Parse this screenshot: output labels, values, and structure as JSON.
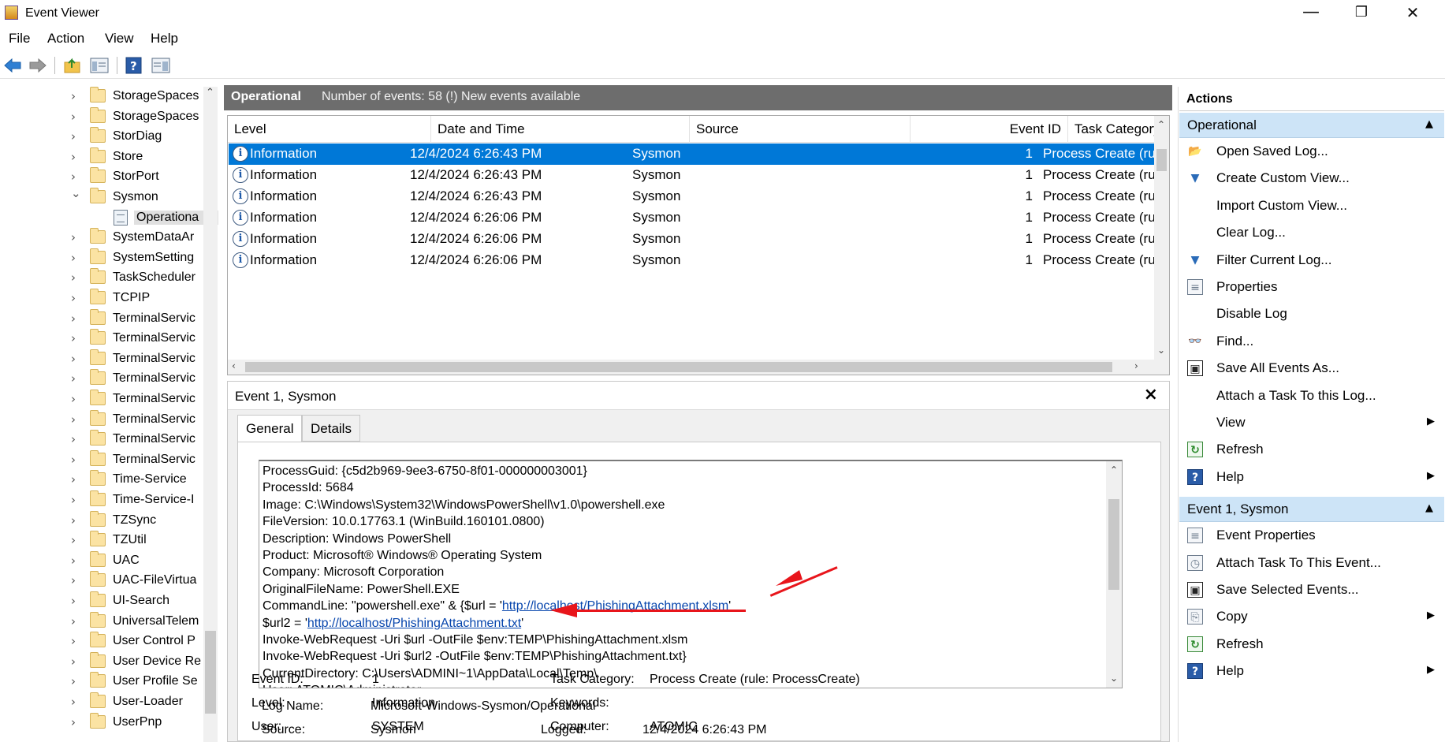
{
  "window": {
    "title": "Event Viewer",
    "minimize": "—",
    "maximize": "❐",
    "close": "✕"
  },
  "menu": [
    "File",
    "Action",
    "View",
    "Help"
  ],
  "tree": {
    "items": [
      {
        "label": "StorageSpaces",
        "expanded": false
      },
      {
        "label": "StorageSpaces",
        "expanded": false
      },
      {
        "label": "StorDiag",
        "expanded": false
      },
      {
        "label": "Store",
        "expanded": false
      },
      {
        "label": "StorPort",
        "expanded": false
      },
      {
        "label": "Sysmon",
        "expanded": true
      },
      {
        "label": "Operationa",
        "selected": true
      },
      {
        "label": "SystemDataAr",
        "expanded": false
      },
      {
        "label": "SystemSetting",
        "expanded": false
      },
      {
        "label": "TaskScheduler",
        "expanded": false
      },
      {
        "label": "TCPIP",
        "expanded": false
      },
      {
        "label": "TerminalServic",
        "expanded": false
      },
      {
        "label": "TerminalServic",
        "expanded": false
      },
      {
        "label": "TerminalServic",
        "expanded": false
      },
      {
        "label": "TerminalServic",
        "expanded": false
      },
      {
        "label": "TerminalServic",
        "expanded": false
      },
      {
        "label": "TerminalServic",
        "expanded": false
      },
      {
        "label": "TerminalServic",
        "expanded": false
      },
      {
        "label": "TerminalServic",
        "expanded": false
      },
      {
        "label": "Time-Service",
        "expanded": false
      },
      {
        "label": "Time-Service-I",
        "expanded": false
      },
      {
        "label": "TZSync",
        "expanded": false
      },
      {
        "label": "TZUtil",
        "expanded": false
      },
      {
        "label": "UAC",
        "expanded": false
      },
      {
        "label": "UAC-FileVirtua",
        "expanded": false
      },
      {
        "label": "UI-Search",
        "expanded": false
      },
      {
        "label": "UniversalTelem",
        "expanded": false
      },
      {
        "label": "User Control P",
        "expanded": false
      },
      {
        "label": "User Device Re",
        "expanded": false
      },
      {
        "label": "User Profile Se",
        "expanded": false
      },
      {
        "label": "User-Loader",
        "expanded": false
      },
      {
        "label": "UserPnp",
        "expanded": false
      }
    ]
  },
  "log_header": {
    "title": "Operational",
    "count": "Number of events: 58 (!) New events available"
  },
  "grid": {
    "columns": [
      "Level",
      "Date and Time",
      "Source",
      "Event ID",
      "Task Category"
    ],
    "rows": [
      {
        "level": "Information",
        "date": "12/4/2024 6:26:43 PM",
        "source": "Sysmon",
        "id": "1",
        "category": "Process Create (rule: P"
      },
      {
        "level": "Information",
        "date": "12/4/2024 6:26:43 PM",
        "source": "Sysmon",
        "id": "1",
        "category": "Process Create (rule: P"
      },
      {
        "level": "Information",
        "date": "12/4/2024 6:26:43 PM",
        "source": "Sysmon",
        "id": "1",
        "category": "Process Create (rule: P"
      },
      {
        "level": "Information",
        "date": "12/4/2024 6:26:06 PM",
        "source": "Sysmon",
        "id": "1",
        "category": "Process Create (rule: P"
      },
      {
        "level": "Information",
        "date": "12/4/2024 6:26:06 PM",
        "source": "Sysmon",
        "id": "1",
        "category": "Process Create (rule: P"
      },
      {
        "level": "Information",
        "date": "12/4/2024 6:26:06 PM",
        "source": "Sysmon",
        "id": "1",
        "category": "Process Create (rule: P"
      }
    ]
  },
  "detail": {
    "title": "Event 1, Sysmon",
    "close": "×",
    "tabs": [
      "General",
      "Details"
    ],
    "message_lines": [
      {
        "text": "ProcessGuid: {c5d2b969-9ee3-6750-8f01-000000003001}"
      },
      {
        "text": "ProcessId: 5684"
      },
      {
        "text": "Image: C:\\Windows\\System32\\WindowsPowerShell\\v1.0\\powershell.exe"
      },
      {
        "text": "FileVersion: 10.0.17763.1 (WinBuild.160101.0800)"
      },
      {
        "text": "Description: Windows PowerShell"
      },
      {
        "text": "Product: Microsoft® Windows® Operating System"
      },
      {
        "text": "Company: Microsoft Corporation"
      },
      {
        "text": "OriginalFileName: PowerShell.EXE"
      },
      {
        "pre": "CommandLine: \"powershell.exe\" & {$url = '",
        "link": "http://localhost/PhishingAttachment.xlsm",
        "post": "'"
      },
      {
        "pre": "$url2 = '",
        "link": "http://localhost/PhishingAttachment.txt",
        "post": "'"
      },
      {
        "text": "Invoke-WebRequest -Uri $url -OutFile $env:TEMP\\PhishingAttachment.xlsm"
      },
      {
        "text": "Invoke-WebRequest -Uri $url2 -OutFile $env:TEMP\\PhishingAttachment.txt}"
      },
      {
        "text": "CurrentDirectory: C:\\Users\\ADMINI~1\\AppData\\Local\\Temp\\"
      },
      {
        "text": "User: ATOMIC\\Administrator"
      }
    ],
    "fields": {
      "log_name_label": "Log Name:",
      "log_name": "Microsoft-Windows-Sysmon/Operational",
      "source_label": "Source:",
      "source": "Sysmon",
      "logged_label": "Logged:",
      "logged": "12/4/2024 6:26:43 PM",
      "event_id_label": "Event ID:",
      "event_id": "1",
      "task_category_label": "Task Category:",
      "task_category": "Process Create (rule: ProcessCreate)",
      "level_label": "Level:",
      "level": "Information",
      "keywords_label": "Keywords:",
      "keywords": "",
      "user_label": "User:",
      "user": "SYSTEM",
      "computer_label": "Computer:",
      "computer": "ATOMIC"
    }
  },
  "actions": {
    "title": "Actions",
    "sections": [
      {
        "title": "Operational",
        "items": [
          {
            "label": "Open Saved Log...",
            "icon": "folder-open-icon",
            "glyph": "📂"
          },
          {
            "label": "Create Custom View...",
            "icon": "funnel-icon",
            "glyph": "▼"
          },
          {
            "label": "Import Custom View...",
            "icon": "",
            "glyph": ""
          },
          {
            "label": "Clear Log...",
            "icon": "",
            "glyph": ""
          },
          {
            "label": "Filter Current Log...",
            "icon": "funnel-icon",
            "glyph": "▼"
          },
          {
            "label": "Properties",
            "icon": "properties-icon",
            "glyph": "≡"
          },
          {
            "label": "Disable Log",
            "icon": "",
            "glyph": ""
          },
          {
            "label": "Find...",
            "icon": "binoculars-icon",
            "glyph": "👓"
          },
          {
            "label": "Save All Events As...",
            "icon": "save-icon",
            "glyph": "▣"
          },
          {
            "label": "Attach a Task To this Log...",
            "icon": "",
            "glyph": ""
          },
          {
            "label": "View",
            "icon": "",
            "glyph": "",
            "submenu": true
          },
          {
            "label": "Refresh",
            "icon": "refresh-icon",
            "glyph": "↻"
          },
          {
            "label": "Help",
            "icon": "help-icon",
            "glyph": "?",
            "submenu": true
          }
        ]
      },
      {
        "title": "Event 1, Sysmon",
        "items": [
          {
            "label": "Event Properties",
            "icon": "properties-icon",
            "glyph": "≡"
          },
          {
            "label": "Attach Task To This Event...",
            "icon": "task-clock-icon",
            "glyph": "◷"
          },
          {
            "label": "Save Selected Events...",
            "icon": "save-icon",
            "glyph": "▣"
          },
          {
            "label": "Copy",
            "icon": "copy-icon",
            "glyph": "⎘",
            "submenu": true
          },
          {
            "label": "Refresh",
            "icon": "refresh-icon",
            "glyph": "↻"
          },
          {
            "label": "Help",
            "icon": "help-icon",
            "glyph": "?",
            "submenu": true
          }
        ]
      }
    ]
  },
  "colors": {
    "selection": "#0078d7",
    "header_gray": "#6d6d6d",
    "section_blue": "#cde4f7",
    "annotation_red": "#e8151b",
    "link": "#0645ad"
  }
}
